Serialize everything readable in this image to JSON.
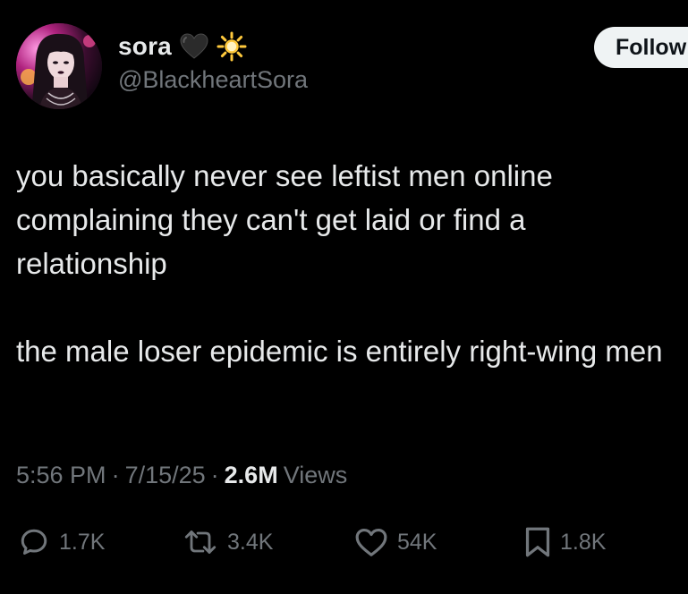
{
  "author": {
    "display_name": "sora",
    "handle": "@BlackheartSora",
    "name_emojis": [
      "black-heart-icon",
      "sun-icon"
    ]
  },
  "follow_button": {
    "label": "Follow"
  },
  "tweet": {
    "paragraphs": [
      "you basically never see leftist men online complaining they can't get laid or find a relationship",
      "the male loser epidemic is entirely right-wing men"
    ]
  },
  "meta": {
    "time": "5:56 PM",
    "separator": "·",
    "date": "7/15/25",
    "views_count": "2.6M",
    "views_label": "Views"
  },
  "actions": {
    "replies": {
      "icon": "reply-icon",
      "count": "1.7K"
    },
    "reposts": {
      "icon": "repost-icon",
      "count": "3.4K"
    },
    "likes": {
      "icon": "heart-icon",
      "count": "54K"
    },
    "bookmarks": {
      "icon": "bookmark-icon",
      "count": "1.8K"
    }
  },
  "colors": {
    "background": "#000000",
    "primary_text": "#e7e9ea",
    "secondary_text": "#71767b",
    "follow_bg": "#eff3f4",
    "follow_text": "#0f1419"
  }
}
